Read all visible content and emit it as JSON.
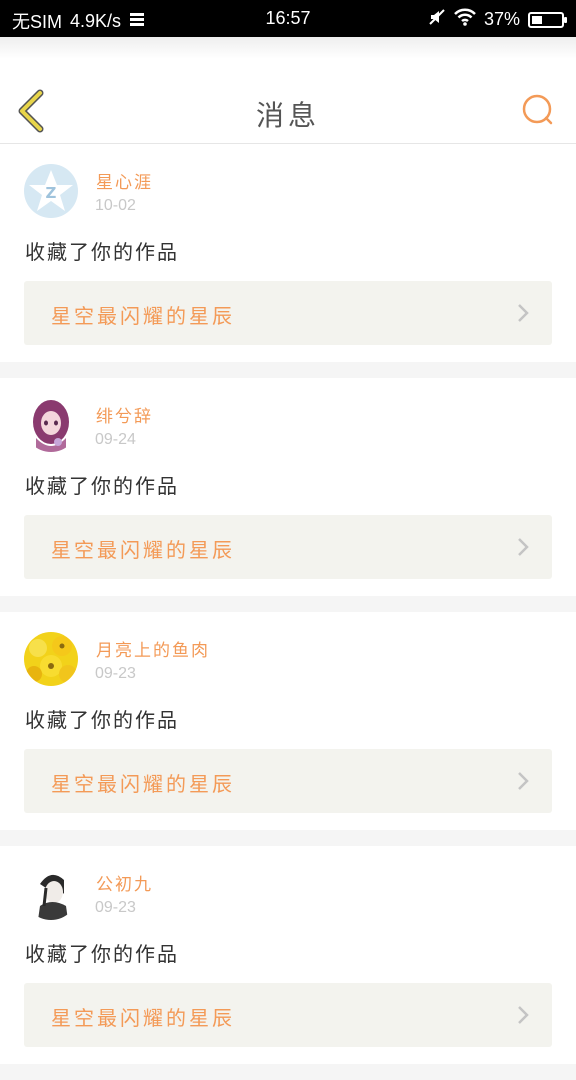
{
  "status_bar": {
    "carrier": "无SIM",
    "speed": "4.9K/s",
    "time": "16:57",
    "battery": "37%",
    "battery_level": 0.37
  },
  "header": {
    "title": "消息"
  },
  "colors": {
    "accent": "#f39a57",
    "back_icon": "#e8d54a"
  },
  "messages": [
    {
      "username": "星心涯",
      "date": "10-02",
      "action": "收藏了你的作品",
      "work_title": "星空最闪耀的星辰",
      "avatar": "qzone-logo-avatar"
    },
    {
      "username": "绯兮辞",
      "date": "09-24",
      "action": "收藏了你的作品",
      "work_title": "星空最闪耀的星辰",
      "avatar": "anime-girl-avatar"
    },
    {
      "username": "月亮上的鱼肉",
      "date": "09-23",
      "action": "收藏了你的作品",
      "work_title": "星空最闪耀的星辰",
      "avatar": "sunflower-avatar"
    },
    {
      "username": "公初九",
      "date": "09-23",
      "action": "收藏了你的作品",
      "work_title": "星空最闪耀的星辰",
      "avatar": "sketch-boy-avatar"
    }
  ]
}
